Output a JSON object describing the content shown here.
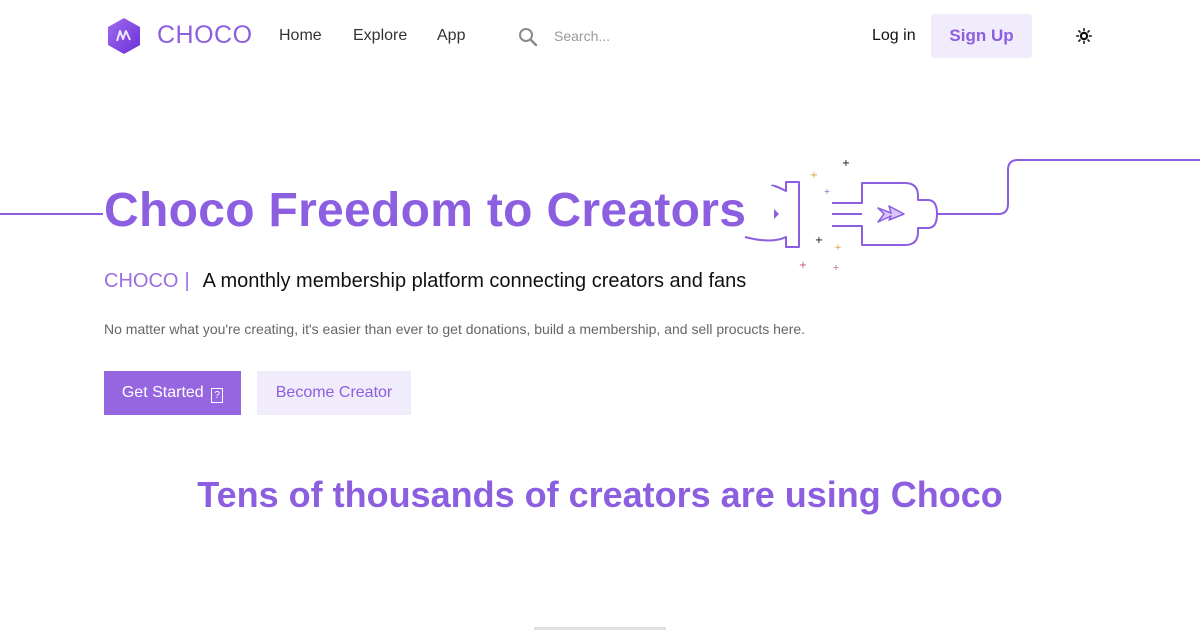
{
  "nav": {
    "logo_text": "CHOCO",
    "links": [
      {
        "label": "Home"
      },
      {
        "label": "Explore"
      },
      {
        "label": "App"
      }
    ],
    "search_placeholder": "Search...",
    "login_label": "Log in",
    "signup_label": "Sign Up",
    "theme_icon": "sun-icon"
  },
  "hero": {
    "title": "Choco Freedom to Creators",
    "tagline_brand": "CHOCO",
    "tagline_separator": "|",
    "tagline_text": "A monthly membership platform connecting creators and fans",
    "subtitle": "No matter what you're creating, it's easier than ever to get donations, build a membership, and sell procucts here.",
    "primary_button": "Get Started",
    "primary_button_glyph": "?",
    "secondary_button": "Become Creator"
  },
  "section": {
    "title": "Tens of thousands of creators are using Choco"
  },
  "colors": {
    "accent": "#8c5ee0",
    "button_primary": "#9566e0",
    "button_soft": "#f1ecfc",
    "text_muted": "#666666"
  }
}
